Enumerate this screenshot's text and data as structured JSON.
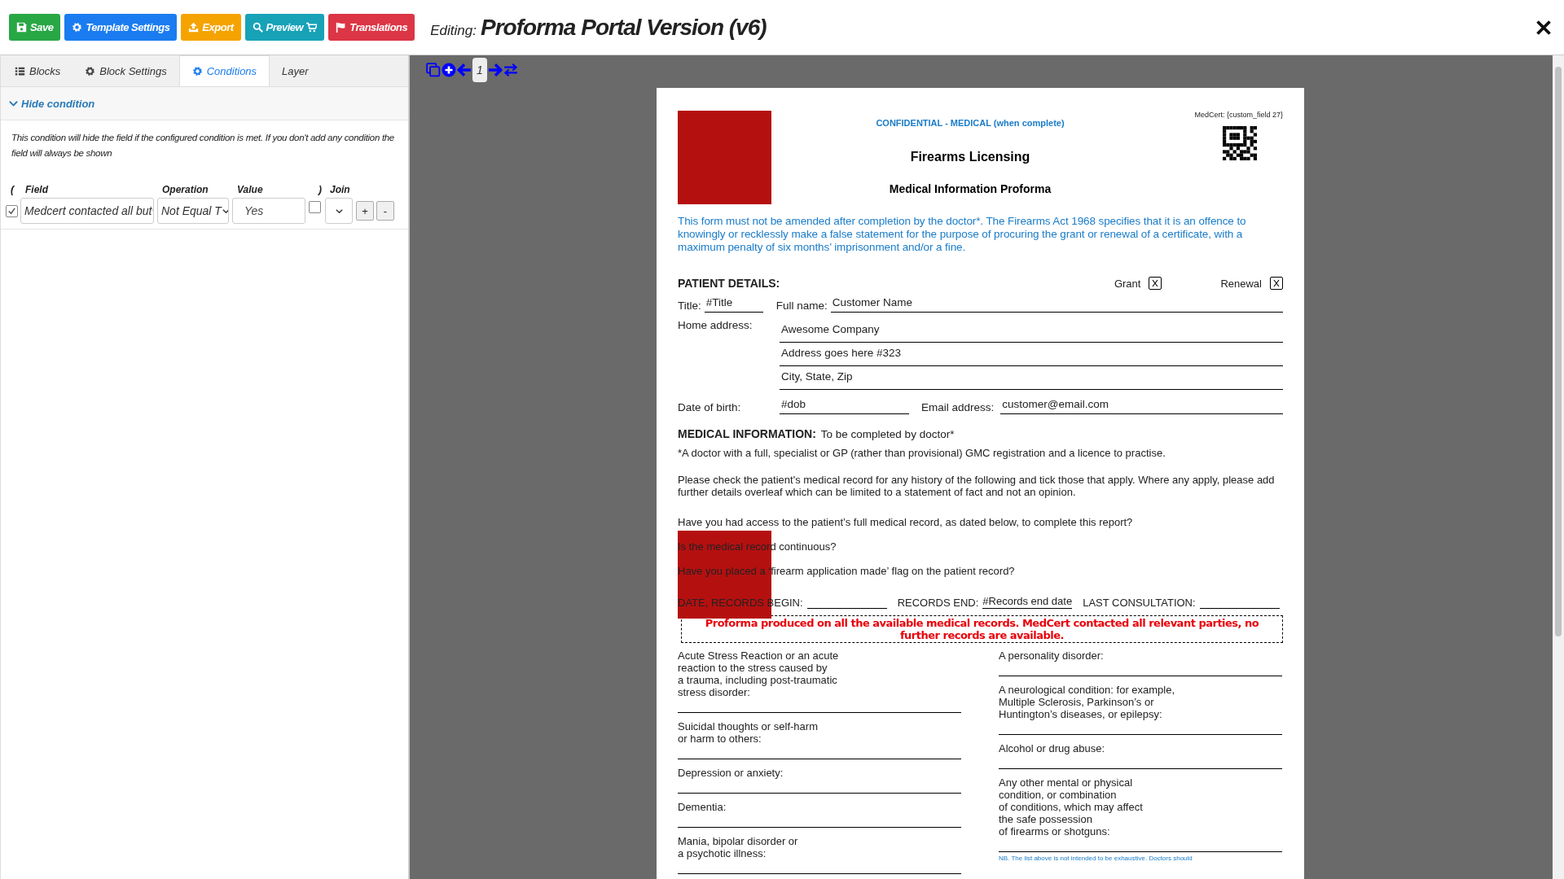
{
  "toolbar": {
    "buttons": [
      {
        "kind": "save",
        "label": "Save"
      },
      {
        "kind": "settings",
        "label": "Template Settings"
      },
      {
        "kind": "export",
        "label": "Export"
      },
      {
        "kind": "preview",
        "label": "Preview"
      },
      {
        "kind": "translations",
        "label": "Translations"
      }
    ],
    "title_prefix": "Editing:",
    "title": "Proforma Portal Version (v6)"
  },
  "tabs": [
    {
      "kind": "blocks",
      "label": "Blocks",
      "selected": false
    },
    {
      "kind": "settings",
      "label": "Block Settings",
      "selected": false
    },
    {
      "kind": "settings",
      "label": "Conditions",
      "selected": true
    },
    {
      "kind": "plain",
      "label": "Layer",
      "selected": false
    }
  ],
  "panel": {
    "section": {
      "title": "Hide condition",
      "expanded": true
    },
    "description": "This condition will hide the field if the configured condition is met. If you don't add any condition the field will always be shown",
    "columns": [
      "(",
      "Field",
      "Operation",
      "Value",
      ")",
      "Join"
    ],
    "conditions": [
      {
        "checked": true,
        "field": "Medcert contacted all but",
        "operation": "Not Equal T",
        "value": "Yes",
        "close_paren": false,
        "add": "+",
        "remove": "-"
      }
    ]
  },
  "canvas_toolbar": {
    "page": "1"
  },
  "document": {
    "confidential": "CONFIDENTIAL - MEDICAL (when complete)",
    "medcert": "MedCert: {custom_field 27}",
    "title": "Firearms Licensing",
    "subtitle": "Medical Information Proforma",
    "warning": "This form must not be amended after completion by the doctor*. The Firearms Act 1968 specifies that it is an offence to knowingly or recklessly make a false statement for the purpose of procuring the grant or renewal of a certificate, with a maximum penalty of six months’ imprisonment and/or a fine.",
    "patient_heading": "PATIENT DETAILS:",
    "options": [
      {
        "label": "Grant",
        "checked": true
      },
      {
        "label": "Renewal",
        "checked": true
      }
    ],
    "title_label": "Title:",
    "title_value": "#Title",
    "name_label": "Full name:",
    "name_value": "Customer Name",
    "address_label": "Home address:",
    "address_lines": [
      "Awesome Company",
      "Address goes here #323",
      "City, State, Zip"
    ],
    "dob_label": "Date of birth:",
    "dob_value": "#dob",
    "email_label": "Email address:",
    "email_value": "customer@email.com",
    "medical_heading": "MEDICAL INFORMATION:",
    "medical_note": "To be completed by doctor*",
    "paragraphs": [
      "*A doctor with a full, specialist or GP (rather than provisional) GMC registration and a licence to practise.",
      "Please check the patient's medical record for any history of the following and tick those that apply. Where any apply, please add further details overleaf which can be limited to a statement of fact and not an opinion."
    ],
    "questions": [
      "Have you had access to the patient’s full medical record, as dated below, to complete this report?",
      "Is the medical record continuous?",
      "Have you placed a ‘firearm application made’ flag on the patient record?"
    ],
    "dates": [
      {
        "label": "DATE, RECORDS BEGIN:"
      },
      {
        "label": "RECORDS END:",
        "value": "#Records end date"
      },
      {
        "label": "LAST CONSULTATION:"
      }
    ],
    "notice": "Proforma produced on all the available medical records. MedCert contacted all relevant parties, no further records are available.",
    "conditions_left": [
      "Acute Stress Reaction or an acute\nreaction to the stress caused by\na trauma, including post-traumatic\nstress disorder:",
      "Suicidal thoughts or self-harm\nor harm to others:",
      "Depression or anxiety:",
      "Dementia:",
      "Mania, bipolar disorder or\na psychotic illness:"
    ],
    "conditions_right": [
      "A personality disorder:",
      "A neurological condition: for example,\nMultiple Sclerosis, Parkinson’s or\nHuntington’s diseases, or epilepsy:",
      "Alcohol or drug abuse:",
      "Any other mental or physical\ncondition, or combination\nof conditions, which may affect\nthe safe possession\nof firearms or shotguns:"
    ],
    "footnote": "NB. The list above is not intended to be exhaustive. Doctors should"
  }
}
